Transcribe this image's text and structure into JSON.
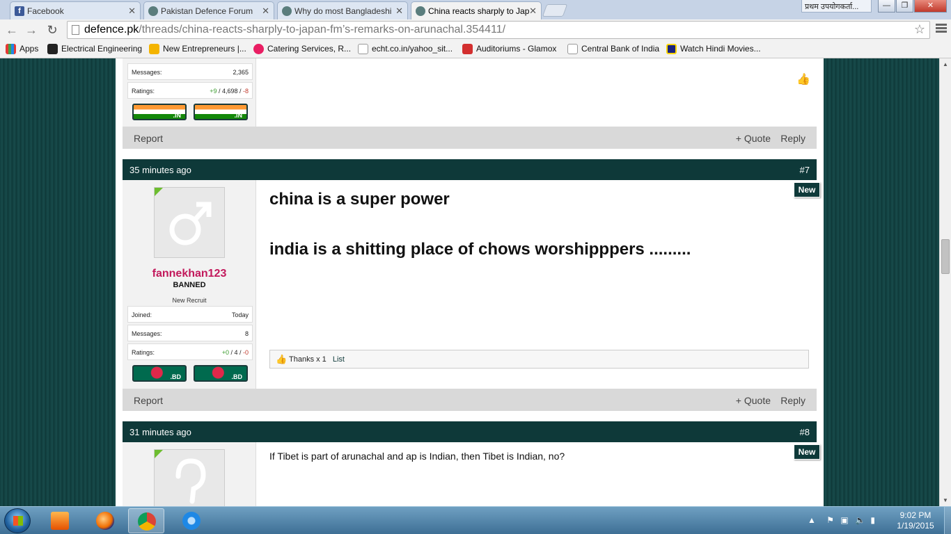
{
  "browser": {
    "tabs": [
      {
        "label": "Facebook",
        "icon": "facebook-icon"
      },
      {
        "label": "Pakistan Defence Forum",
        "icon": "site-favicon"
      },
      {
        "label": "Why do most Bangladeshi",
        "icon": "site-favicon"
      },
      {
        "label": "China reacts sharply to Jap",
        "icon": "site-favicon"
      }
    ],
    "user_badge": "प्रथम उपयोगकर्ता...",
    "url_domain": "defence.pk",
    "url_path": "/threads/china-reacts-sharply-to-japan-fm’s-remarks-on-arunachal.354411/",
    "bookmarks": [
      "Apps",
      "Electrical Engineering",
      "New Entrepreneurs |...",
      "Catering Services, R...",
      "echt.co.in/yahoo_sit...",
      "Auditoriums - Glamox",
      "Central Bank of India",
      "Watch Hindi Movies..."
    ]
  },
  "post6": {
    "messages_label": "Messages:",
    "messages_value": "2,365",
    "ratings_label": "Ratings:",
    "ratings_pos": "+9",
    "ratings_mid": " / 4,698 / ",
    "ratings_neg": "-8",
    "flag_code": ".IN",
    "report": "Report",
    "quote": "+ Quote",
    "reply": "Reply"
  },
  "post7": {
    "time": "35 minutes ago",
    "number": "#7",
    "new_badge": "New",
    "username": "fannekhan123",
    "user_title": "BANNED",
    "rank": "New Recruit",
    "joined_label": "Joined:",
    "joined_value": "Today",
    "messages_label": "Messages:",
    "messages_value": "8",
    "ratings_label": "Ratings:",
    "ratings_pos": "+0",
    "ratings_mid": " / 4 / ",
    "ratings_neg": "-0",
    "flag_code": ".BD",
    "line1": "china is a super power",
    "line2": "india is a shitting place of chows worshipppers .........",
    "thanks": "Thanks x 1",
    "thanks_list": "List",
    "report": "Report",
    "quote": "+ Quote",
    "reply": "Reply"
  },
  "post8": {
    "time": "31 minutes ago",
    "number": "#8",
    "new_badge": "New",
    "message": "If Tibet is part of arunachal and ap is Indian, then Tibet is Indian, no?"
  },
  "taskbar": {
    "time": "9:02 PM",
    "date": "1/19/2015"
  }
}
